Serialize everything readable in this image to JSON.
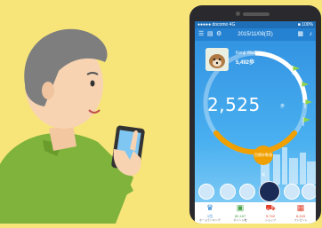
{
  "status_bar": {
    "carrier": "●●●●● docomo 4G",
    "time": "",
    "battery": "■ 100%"
  },
  "top_nav": {
    "date": "2015/11/08(日)"
  },
  "profile": {
    "name": "Kenji Wada",
    "rank": "5,492歩"
  },
  "steps": {
    "value": "2,525",
    "unit": "歩"
  },
  "goal_button": {
    "label": "目標歩数達成"
  },
  "bottom_bar": [
    {
      "icon": "home-icon",
      "value": "1位",
      "sub": "ホームランキング"
    },
    {
      "icon": "money-icon",
      "value": "80,187",
      "sub": "ポイント数"
    },
    {
      "icon": "cart-icon",
      "value": "5,742",
      "sub": "ショップ"
    },
    {
      "icon": "gift-icon",
      "value": "6,243",
      "sub": "プレゼント"
    }
  ],
  "colors": {
    "background": "#f7e57a",
    "phone_screen": "#2f8fe0",
    "accent": "#f0a000",
    "shirt": "#7fb33b"
  }
}
